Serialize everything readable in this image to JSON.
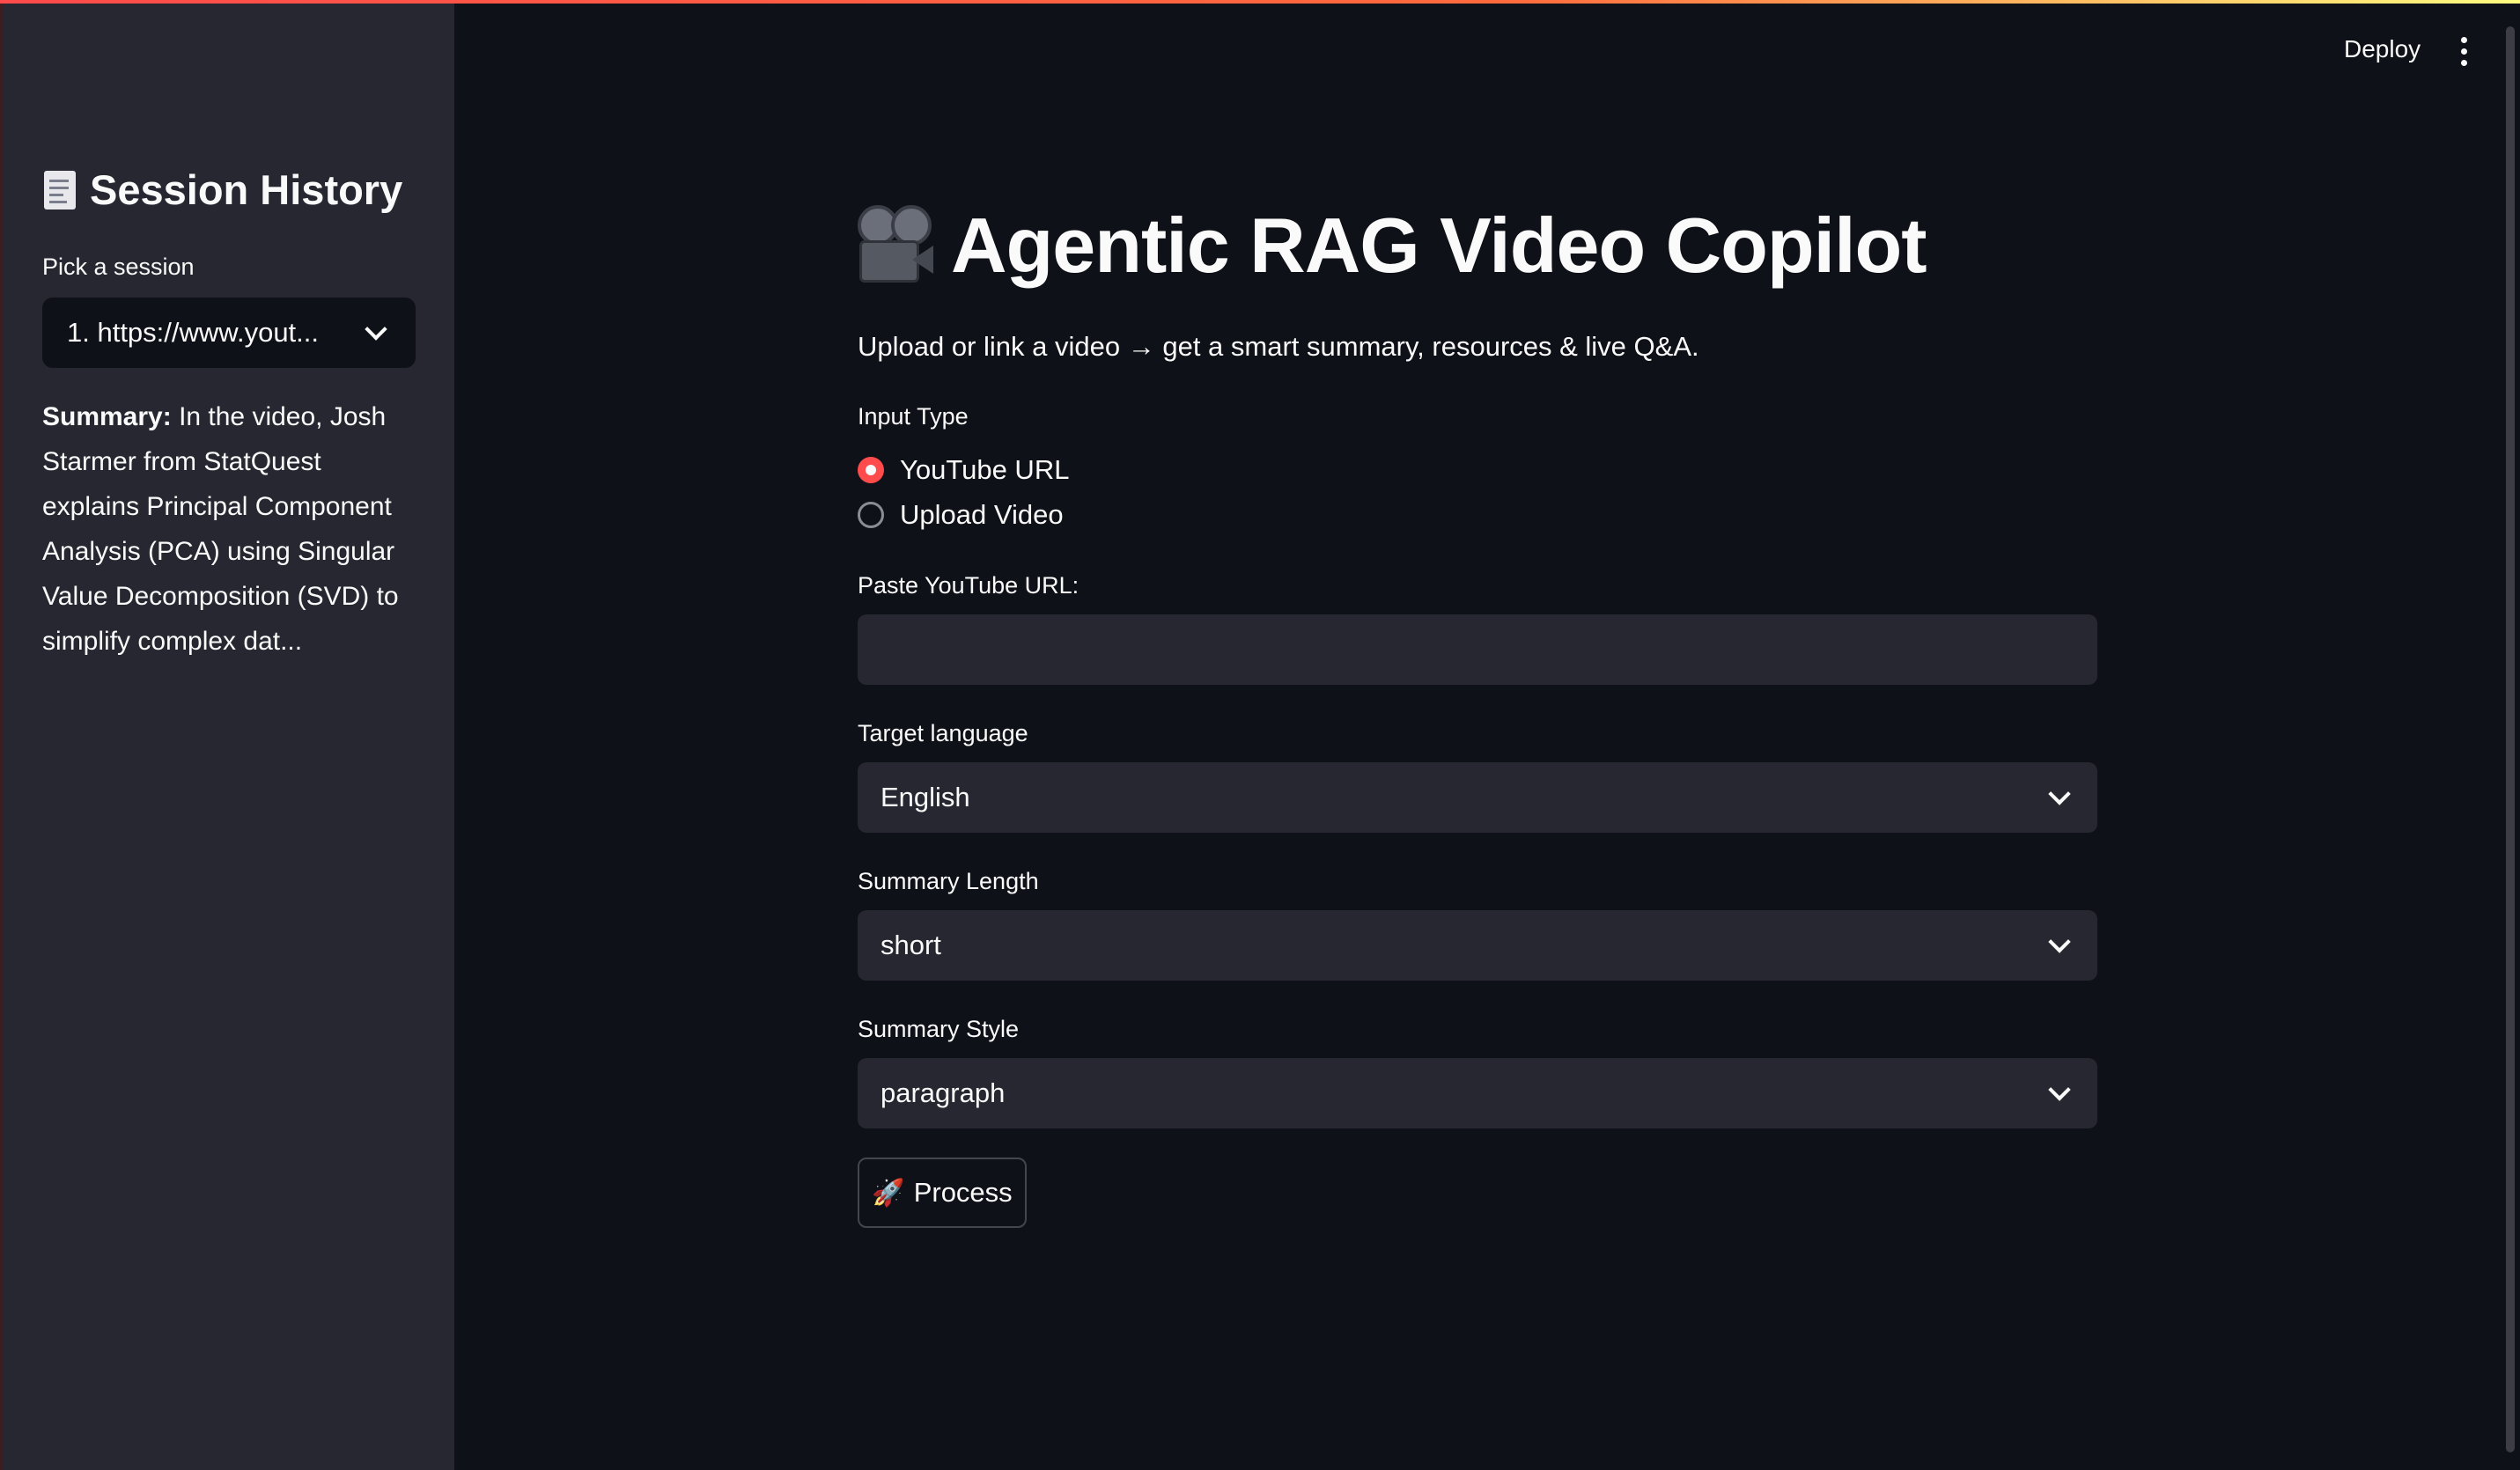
{
  "header": {
    "deploy_label": "Deploy",
    "menu_icon": "kebab-menu-icon"
  },
  "sidebar": {
    "title": "Session History",
    "title_icon": "document-icon",
    "session_label": "Pick a session",
    "session_value": "1. https://www.yout...",
    "summary_label": "Summary:",
    "summary_text": "In the video, Josh Starmer from StatQuest explains Principal Component Analysis (PCA) using Singular Value Decomposition (SVD) to simplify complex dat..."
  },
  "main": {
    "title": "Agentic RAG Video Copilot",
    "title_icon": "movie-camera-icon",
    "subtitle": "Upload or link a video → get a smart summary, resources & live Q&A.",
    "input_type": {
      "label": "Input Type",
      "options": [
        "YouTube URL",
        "Upload Video"
      ],
      "selected": "YouTube URL"
    },
    "url_field": {
      "label": "Paste YouTube URL:",
      "value": ""
    },
    "target_language": {
      "label": "Target language",
      "value": "English"
    },
    "summary_length": {
      "label": "Summary Length",
      "value": "short"
    },
    "summary_style": {
      "label": "Summary Style",
      "value": "paragraph"
    },
    "process_button": {
      "icon": "rocket-icon",
      "label": "Process"
    }
  },
  "colors": {
    "background": "#0e1117",
    "sidebar": "#262730",
    "accent": "#ff4b4b",
    "input_bg": "#262730",
    "text": "#fafafa"
  }
}
